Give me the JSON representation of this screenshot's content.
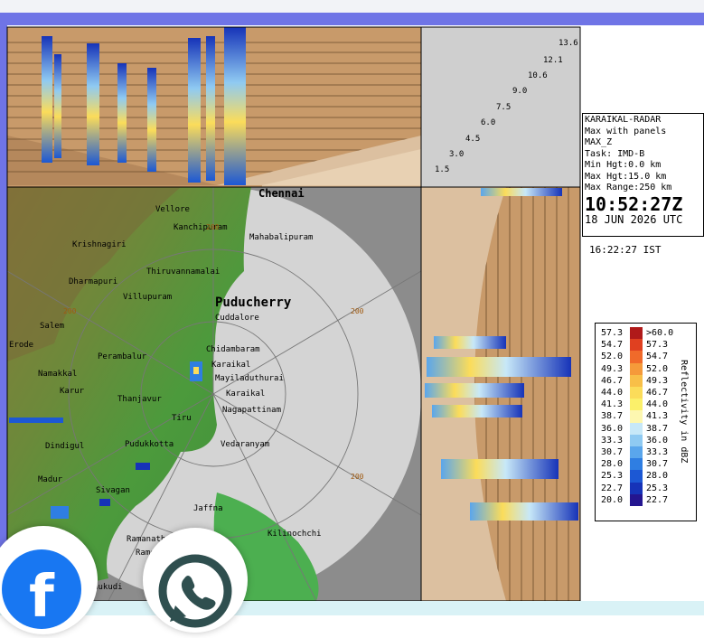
{
  "panel": {
    "radar_name": "KARAIKAL-RADAR",
    "mode": "Max with panels",
    "product": "MAX_Z",
    "task": "Task: IMD-B",
    "min_hgt": "Min Hgt:0.0 km",
    "max_hgt": "Max Hgt:15.0 km",
    "max_range": "Max Range:250 km",
    "time_utc": "10:52:27Z",
    "date_utc": "18 JUN 2026 UTC",
    "time_ist": "16:22:27 IST"
  },
  "heights": [
    "1.5",
    "3.0",
    "4.5",
    "6.0",
    "7.5",
    "9.0",
    "10.6",
    "12.1",
    "13.6"
  ],
  "legend": {
    "unit": "Reflectivity in dBZ",
    "rows": [
      {
        "lo": "57.3",
        "hi": ">60.0",
        "color": "#b01a1a"
      },
      {
        "lo": "54.7",
        "hi": "57.3",
        "color": "#e04020"
      },
      {
        "lo": "52.0",
        "hi": "54.7",
        "color": "#f06a2a"
      },
      {
        "lo": "49.3",
        "hi": "52.0",
        "color": "#f59a3a"
      },
      {
        "lo": "46.7",
        "hi": "49.3",
        "color": "#f8bf48"
      },
      {
        "lo": "44.0",
        "hi": "46.7",
        "color": "#fbdc5a"
      },
      {
        "lo": "41.3",
        "hi": "44.0",
        "color": "#fbf06a"
      },
      {
        "lo": "38.7",
        "hi": "41.3",
        "color": "#fdf7b0"
      },
      {
        "lo": "36.0",
        "hi": "38.7",
        "color": "#c7e8f8"
      },
      {
        "lo": "33.3",
        "hi": "36.0",
        "color": "#8fcaf2"
      },
      {
        "lo": "30.7",
        "hi": "33.3",
        "color": "#5aa6ec"
      },
      {
        "lo": "28.0",
        "hi": "30.7",
        "color": "#2f7ee2"
      },
      {
        "lo": "25.3",
        "hi": "28.0",
        "color": "#1c58d4"
      },
      {
        "lo": "22.7",
        "hi": "25.3",
        "color": "#1633b8"
      },
      {
        "lo": "20.0",
        "hi": "22.7",
        "color": "#241590"
      }
    ]
  },
  "places": {
    "chennai": "Chennai",
    "vellore": "Vellore",
    "kanchipuram": "Kanchipuram",
    "mahabalipuram": "Mahabalipuram",
    "krishnagiri": "Krishnagiri",
    "tiruvannamalai": "Thiruvannamalai",
    "dharmapuri": "Dharmapuri",
    "villupuram": "Villupuram",
    "puducherry": "Puducherry",
    "cuddalore": "Cuddalore",
    "salem": "Salem",
    "erode": "Erode",
    "chidambaram": "Chidambaram",
    "perambalur": "Perambalur",
    "karaikal": "Karaikal",
    "karaikal_dot": "Karaikal",
    "mayiladuthurai": "Mayiladuthurai",
    "namakkal": "Namakkal",
    "karur": "Karur",
    "thanjavur": "Thanjavur",
    "nagapattinam": "Nagapattinam",
    "tiruvarur": "Tiru",
    "dindigul": "Dindigul",
    "pudukkottai": "Pudukkotta",
    "vedaranyam": "Vedaranyam",
    "madurai": "Madur",
    "sivaganga": "Sivagan",
    "jaffna": "Jaffna",
    "kilinochchi": "Kilinochchi",
    "ramanathapuram": "Ramanathapuram",
    "rameswaram": "Rameswaram",
    "thoothukudi": "Thoothukudi"
  },
  "range_labels": {
    "east": "200",
    "southeast": "200",
    "map_west": "200",
    "map_north": "200"
  },
  "share": {
    "facebook_letter": "f"
  },
  "colors": {
    "frame": "#6f74e6",
    "land": "#4caf50",
    "sea_range": "#d4d4d4",
    "panel_bg": "#c89a6a"
  }
}
